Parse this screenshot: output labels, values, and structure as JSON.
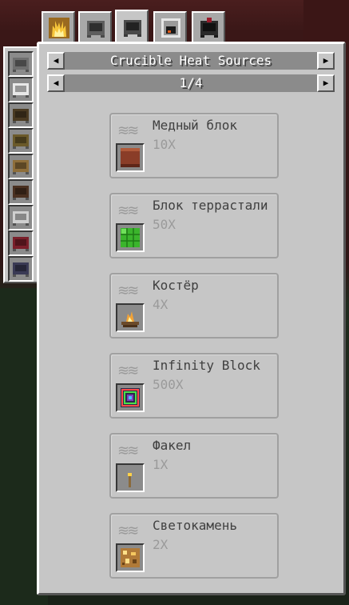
{
  "tabs": [
    {
      "icon": "heat-sources-icon",
      "active": false
    },
    {
      "icon": "crucible-icon",
      "active": false
    },
    {
      "icon": "crucible-icon",
      "active": true
    },
    {
      "icon": "furnace-icon",
      "active": false
    },
    {
      "icon": "infernal-crucible-icon",
      "active": false
    }
  ],
  "catalysts": [
    {
      "icon": "stone-crucible-icon",
      "color": "#6f6f6f"
    },
    {
      "icon": "porcelain-crucible-icon",
      "color": "#e8e8e8"
    },
    {
      "icon": "oak-crucible-icon",
      "color": "#4a3a22"
    },
    {
      "icon": "spruce-crucible-icon",
      "color": "#6b5a2a"
    },
    {
      "icon": "birch-crucible-icon",
      "color": "#8e6e3a"
    },
    {
      "icon": "dark-oak-crucible-icon",
      "color": "#4a3020"
    },
    {
      "icon": "white-crucible-icon",
      "color": "#cfcfcf"
    },
    {
      "icon": "crimson-crucible-icon",
      "color": "#7a1f2a"
    },
    {
      "icon": "warped-crucible-icon",
      "color": "#3a3a55"
    }
  ],
  "header": {
    "title": "Crucible Heat Sources",
    "page": "1/4",
    "prev_arrow": "◀",
    "next_arrow": "▶"
  },
  "heat_glyph": "≋≋",
  "recipes": [
    {
      "name": "Медный блок",
      "rate": "10X",
      "icon": "copper-block-icon",
      "color": "#8a3d28"
    },
    {
      "name": "Блок террастали",
      "rate": "50X",
      "icon": "terrasteel-block-icon",
      "color": "#3bb52c"
    },
    {
      "name": "Костёр",
      "rate": "4X",
      "icon": "campfire-icon",
      "color": "#f2a236"
    },
    {
      "name": "Infinity Block",
      "rate": "500X",
      "icon": "infinity-block-icon",
      "color": "#7a3fbf"
    },
    {
      "name": "Факел",
      "rate": "1X",
      "icon": "torch-icon",
      "color": "#8a6a3a"
    },
    {
      "name": "Светокамень",
      "rate": "2X",
      "icon": "glowstone-icon",
      "color": "#b07a38"
    }
  ]
}
